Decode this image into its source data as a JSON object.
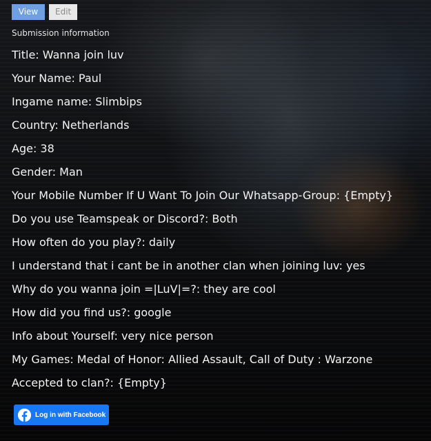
{
  "tabs": {
    "view_label": "View",
    "edit_label": "Edit"
  },
  "section_title": "Submission information",
  "fields": [
    "Title: Wanna join luv",
    "Your Name: Paul",
    "Ingame name: Slimbips",
    "Country: Netherlands",
    "Age: 38",
    "Gender: Man",
    "Your Mobile Number If U Want To Join Our Whatsapp-Group: {Empty}",
    "Do you use Teamspeak or Discord?: Both",
    "How often do you play?: daily",
    "I understand that i cant be in another clan when joining luv: yes",
    "Why do you wanna join =|LuV|=?: they are cool",
    "How did you find us?: google",
    "Info about Yourself: very nice person",
    "My Games: Medal of Honor: Allied Assault, Call of Duty : Warzone",
    "Accepted to clan?: {Empty}"
  ],
  "facebook_login": {
    "label": "Log in with Facebook",
    "icon": "facebook-icon",
    "color": "#1877f2"
  },
  "colors": {
    "view_tab": "#6f9fe0",
    "edit_tab": "#e8e8e8",
    "text": "#f4f4f4"
  }
}
